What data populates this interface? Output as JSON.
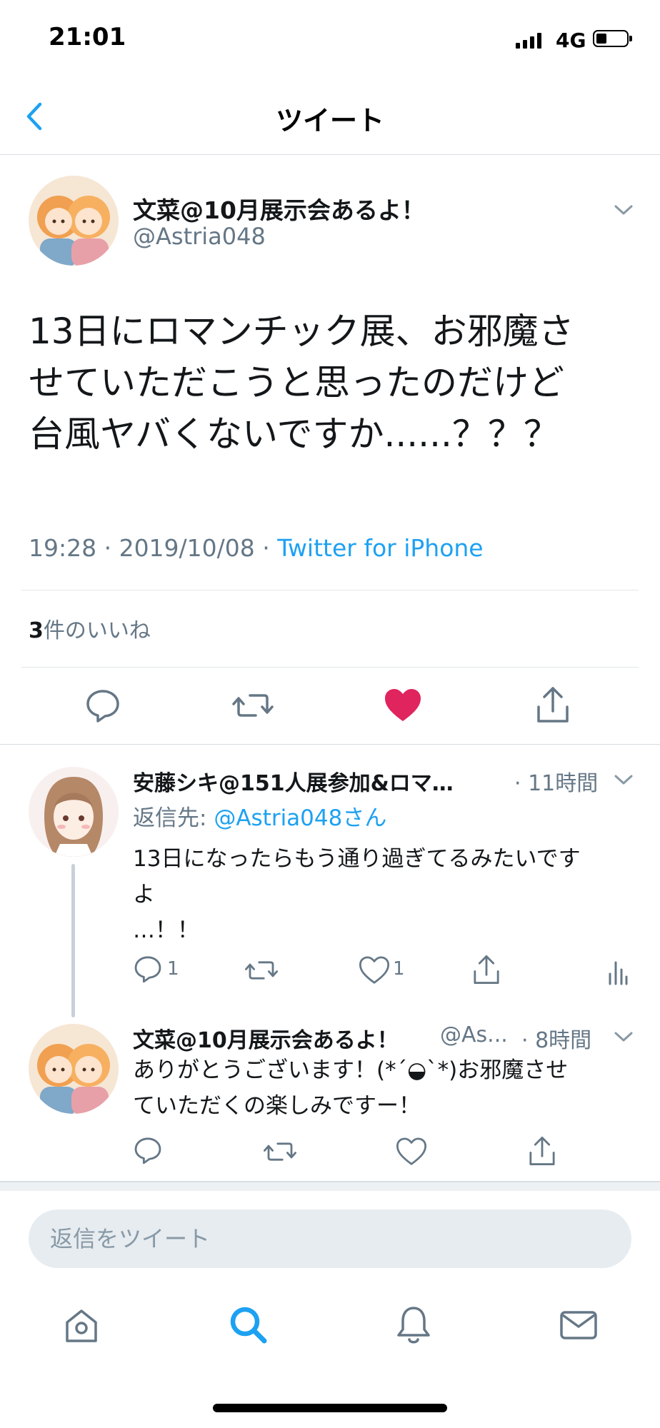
{
  "status": {
    "time": "21:01",
    "network": "4G"
  },
  "nav": {
    "title": "ツイート"
  },
  "tweet": {
    "name": "文菜@10月展示会あるよ！",
    "handle": "@Astria048",
    "lines": [
      "13日にロマンチック展、お邪魔さ",
      "せていただこうと思ったのだけど",
      "台風ヤバくないですか......？？？"
    ],
    "time": "19:28 · 2019/10/08 · ",
    "source": "Twitter for iPhone",
    "likes_count": "3",
    "likes_label": "件のいいね"
  },
  "replies": [
    {
      "name": "安藤シキ@151人展参加&ロマ…",
      "time": "· 11時間",
      "reply_to_label": "返信先: ",
      "reply_to_mention": "@Astria048さん",
      "lines": [
        "13日になったらもう通り過ぎてるみたいです",
        "よ",
        "…！！"
      ],
      "reply_count": "1",
      "like_count": "1"
    },
    {
      "name": "文菜@10月展示会あるよ！",
      "handle": "@As...",
      "time": "· 8時間",
      "lines": [
        "ありがとうございます！(*´◒`*)お邪魔させ",
        "ていただくの楽しみですー！"
      ]
    }
  ],
  "compose": {
    "placeholder": "返信をツイート"
  },
  "colors": {
    "accent": "#1da1f2",
    "like": "#e0245e",
    "secondary": "#657786"
  }
}
